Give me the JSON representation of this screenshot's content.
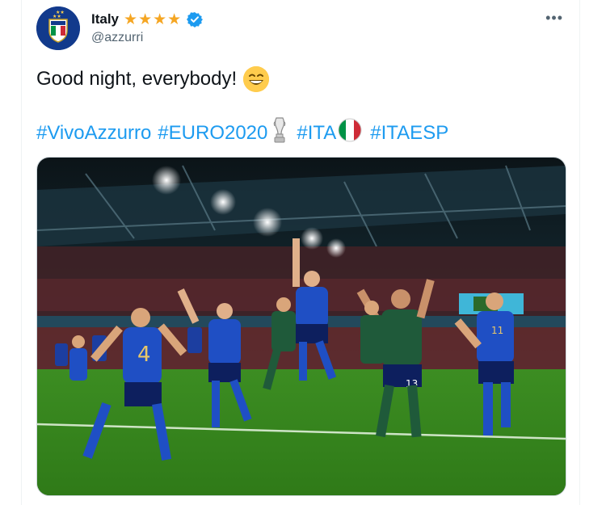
{
  "tweet": {
    "display_name": "Italy",
    "star_count": 4,
    "handle": "@azzurri",
    "text": "Good night, everybody!",
    "emoji_icon": "grinning-face-with-smiling-eyes-icon",
    "hashtags": [
      "#VivoAzzurro",
      "#EURO2020",
      "#ITA",
      "#ITAESP"
    ]
  },
  "colors": {
    "link": "#1d9bf0",
    "star": "#f5a623",
    "verified": "#1d9bf0",
    "avatar": "#123a8c"
  },
  "media": {
    "description_icon": "stadium-photo",
    "shirt_numbers": [
      "4",
      "11",
      "13"
    ]
  }
}
